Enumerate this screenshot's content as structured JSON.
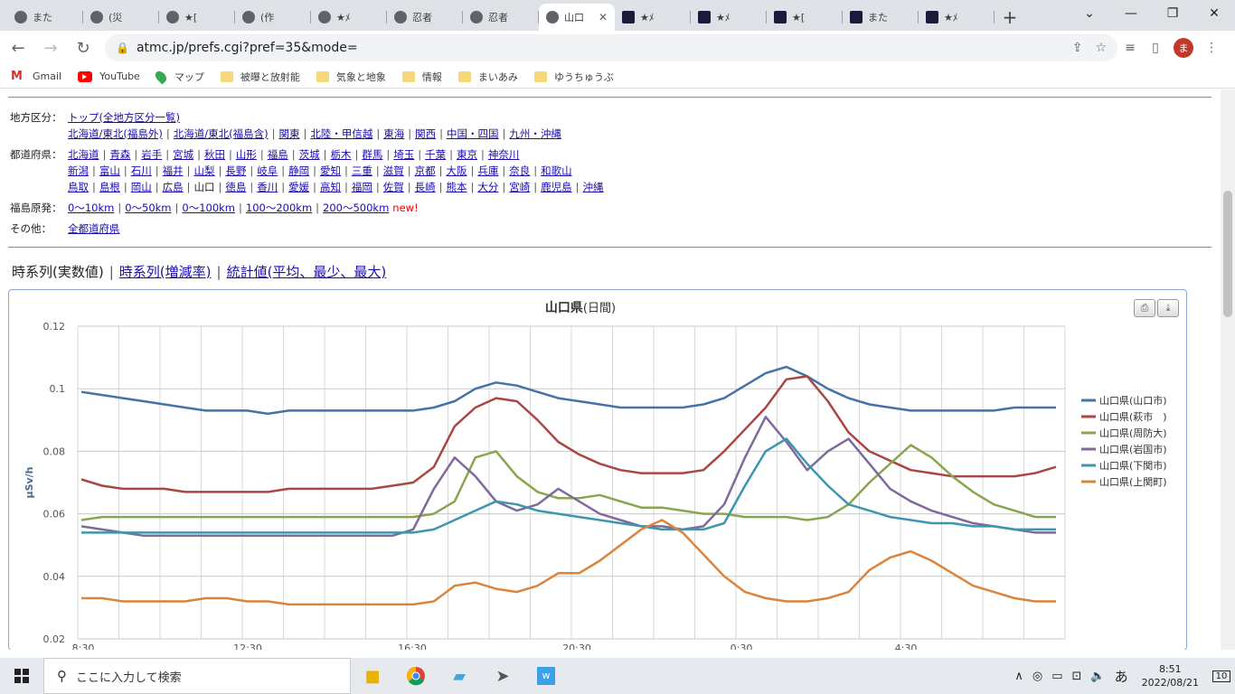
{
  "browser": {
    "tabs": [
      {
        "title": "また",
        "icon": "globe-icon"
      },
      {
        "title": "(災",
        "icon": "globe-icon"
      },
      {
        "title": "★[",
        "icon": "globe-icon"
      },
      {
        "title": "(作",
        "icon": "globe-icon"
      },
      {
        "title": "★ﾒ",
        "icon": "globe-icon"
      },
      {
        "title": "忍者",
        "icon": "globe-icon"
      },
      {
        "title": "忍者",
        "icon": "globe-icon"
      },
      {
        "title": "山口",
        "icon": "globe-icon",
        "active": true
      },
      {
        "title": "★ﾒ",
        "icon": "site-icon"
      },
      {
        "title": "★ﾒ",
        "icon": "site-icon"
      },
      {
        "title": "★[",
        "icon": "site-icon"
      },
      {
        "title": "また",
        "icon": "site-icon"
      },
      {
        "title": "★ﾒ",
        "icon": "site-icon"
      }
    ],
    "url": "atmc.jp/prefs.cgi?pref=35&mode=",
    "profile_initial": "ま",
    "bookmarks": [
      {
        "label": "Gmail",
        "icon": "gmail-icon"
      },
      {
        "label": "YouTube",
        "icon": "youtube-icon"
      },
      {
        "label": "マップ",
        "icon": "maps-icon"
      },
      {
        "label": "被曝と放射能",
        "icon": "folder-icon"
      },
      {
        "label": "気象と地象",
        "icon": "folder-icon"
      },
      {
        "label": "情報",
        "icon": "folder-icon"
      },
      {
        "label": "まいあみ",
        "icon": "folder-icon"
      },
      {
        "label": "ゆうちゅうぶ",
        "icon": "folder-icon"
      }
    ]
  },
  "nav": {
    "region_label": "地方区分：",
    "region_row1": [
      "トップ(全地方区分一覧)"
    ],
    "region_row2": [
      "北海道/東北(福島外)",
      "北海道/東北(福島含)",
      "関東",
      "北陸・甲信越",
      "東海",
      "関西",
      "中国・四国",
      "九州・沖縄"
    ],
    "pref_label": "都道府県：",
    "pref_row1": [
      "北海道",
      "青森",
      "岩手",
      "宮城",
      "秋田",
      "山形",
      "福島",
      "茨城",
      "栃木",
      "群馬",
      "埼玉",
      "千葉",
      "東京",
      "神奈川"
    ],
    "pref_row2": [
      "新潟",
      "富山",
      "石川",
      "福井",
      "山梨",
      "長野",
      "岐阜",
      "静岡",
      "愛知",
      "三重",
      "滋賀",
      "京都",
      "大阪",
      "兵庫",
      "奈良",
      "和歌山"
    ],
    "pref_row3": [
      "鳥取",
      "島根",
      "岡山",
      "広島",
      "山口",
      "徳島",
      "香川",
      "愛媛",
      "高知",
      "福岡",
      "佐賀",
      "長崎",
      "熊本",
      "大分",
      "宮崎",
      "鹿児島",
      "沖縄"
    ],
    "pref_current": "山口",
    "fukushima_label": "福島原発：",
    "fukushima_links": [
      "0～10km",
      "0～50km",
      "0～100km",
      "100～200km",
      "200～500km"
    ],
    "new_mark": "new!",
    "other_label": "その他：",
    "other_links": [
      "全都道府県"
    ]
  },
  "view_tabs": {
    "current": "時系列(実数値)",
    "link1": "時系列(増減率)",
    "link2": "統計値(平均、最少、最大)"
  },
  "chart_data": {
    "type": "line",
    "title": "山口県",
    "subtitle": "(日間)",
    "ylabel": "μSv/h",
    "ylim": [
      0.02,
      0.12
    ],
    "yticks": [
      "0.12",
      "0.1",
      "0.08",
      "0.06",
      "0.04",
      "0.02"
    ],
    "x_tick_labels": [
      "8:30",
      "12:30",
      "16:30",
      "20:30",
      "0:30",
      "4:30"
    ],
    "series": [
      {
        "name": "山口県(山口市)",
        "color": "#4572a7",
        "values": [
          0.099,
          0.098,
          0.097,
          0.096,
          0.095,
          0.094,
          0.093,
          0.093,
          0.093,
          0.092,
          0.093,
          0.093,
          0.093,
          0.093,
          0.093,
          0.093,
          0.093,
          0.094,
          0.096,
          0.1,
          0.102,
          0.101,
          0.099,
          0.097,
          0.096,
          0.095,
          0.094,
          0.094,
          0.094,
          0.094,
          0.095,
          0.097,
          0.101,
          0.105,
          0.107,
          0.104,
          0.1,
          0.097,
          0.095,
          0.094,
          0.093,
          0.093,
          0.093,
          0.093,
          0.093,
          0.094,
          0.094,
          0.094
        ]
      },
      {
        "name": "山口県(萩市　)",
        "color": "#aa4643",
        "values": [
          0.071,
          0.069,
          0.068,
          0.068,
          0.068,
          0.067,
          0.067,
          0.067,
          0.067,
          0.067,
          0.068,
          0.068,
          0.068,
          0.068,
          0.068,
          0.069,
          0.07,
          0.075,
          0.088,
          0.094,
          0.097,
          0.096,
          0.09,
          0.083,
          0.079,
          0.076,
          0.074,
          0.073,
          0.073,
          0.073,
          0.074,
          0.08,
          0.087,
          0.094,
          0.103,
          0.104,
          0.096,
          0.086,
          0.08,
          0.077,
          0.074,
          0.073,
          0.072,
          0.072,
          0.072,
          0.072,
          0.073,
          0.075
        ]
      },
      {
        "name": "山口県(周防大)",
        "color": "#89a54e",
        "values": [
          0.058,
          0.059,
          0.059,
          0.059,
          0.059,
          0.059,
          0.059,
          0.059,
          0.059,
          0.059,
          0.059,
          0.059,
          0.059,
          0.059,
          0.059,
          0.059,
          0.059,
          0.06,
          0.064,
          0.078,
          0.08,
          0.072,
          0.067,
          0.065,
          0.065,
          0.066,
          0.064,
          0.062,
          0.062,
          0.061,
          0.06,
          0.06,
          0.059,
          0.059,
          0.059,
          0.058,
          0.059,
          0.063,
          0.07,
          0.076,
          0.082,
          0.078,
          0.072,
          0.067,
          0.063,
          0.061,
          0.059,
          0.059
        ]
      },
      {
        "name": "山口県(岩国市)",
        "color": "#80699b",
        "values": [
          0.056,
          0.055,
          0.054,
          0.053,
          0.053,
          0.053,
          0.053,
          0.053,
          0.053,
          0.053,
          0.053,
          0.053,
          0.053,
          0.053,
          0.053,
          0.053,
          0.055,
          0.068,
          0.078,
          0.072,
          0.064,
          0.061,
          0.063,
          0.068,
          0.064,
          0.06,
          0.058,
          0.056,
          0.056,
          0.055,
          0.056,
          0.063,
          0.078,
          0.091,
          0.083,
          0.074,
          0.08,
          0.084,
          0.076,
          0.068,
          0.064,
          0.061,
          0.059,
          0.057,
          0.056,
          0.055,
          0.054,
          0.054
        ]
      },
      {
        "name": "山口県(下関市)",
        "color": "#3d96ae",
        "values": [
          0.054,
          0.054,
          0.054,
          0.054,
          0.054,
          0.054,
          0.054,
          0.054,
          0.054,
          0.054,
          0.054,
          0.054,
          0.054,
          0.054,
          0.054,
          0.054,
          0.054,
          0.055,
          0.058,
          0.061,
          0.064,
          0.063,
          0.061,
          0.06,
          0.059,
          0.058,
          0.057,
          0.056,
          0.055,
          0.055,
          0.055,
          0.057,
          0.069,
          0.08,
          0.084,
          0.076,
          0.069,
          0.063,
          0.061,
          0.059,
          0.058,
          0.057,
          0.057,
          0.056,
          0.056,
          0.055,
          0.055,
          0.055
        ]
      },
      {
        "name": "山口県(上関町)",
        "color": "#db843d",
        "values": [
          0.033,
          0.033,
          0.032,
          0.032,
          0.032,
          0.032,
          0.033,
          0.033,
          0.032,
          0.032,
          0.031,
          0.031,
          0.031,
          0.031,
          0.031,
          0.031,
          0.031,
          0.032,
          0.037,
          0.038,
          0.036,
          0.035,
          0.037,
          0.041,
          0.041,
          0.045,
          0.05,
          0.055,
          0.058,
          0.054,
          0.047,
          0.04,
          0.035,
          0.033,
          0.032,
          0.032,
          0.033,
          0.035,
          0.042,
          0.046,
          0.048,
          0.045,
          0.041,
          0.037,
          0.035,
          0.033,
          0.032,
          0.032
        ]
      }
    ]
  },
  "taskbar": {
    "search_placeholder": "ここに入力して検索",
    "ime": "あ",
    "time": "8:51",
    "date": "2022/08/21",
    "notif_count": "10"
  }
}
